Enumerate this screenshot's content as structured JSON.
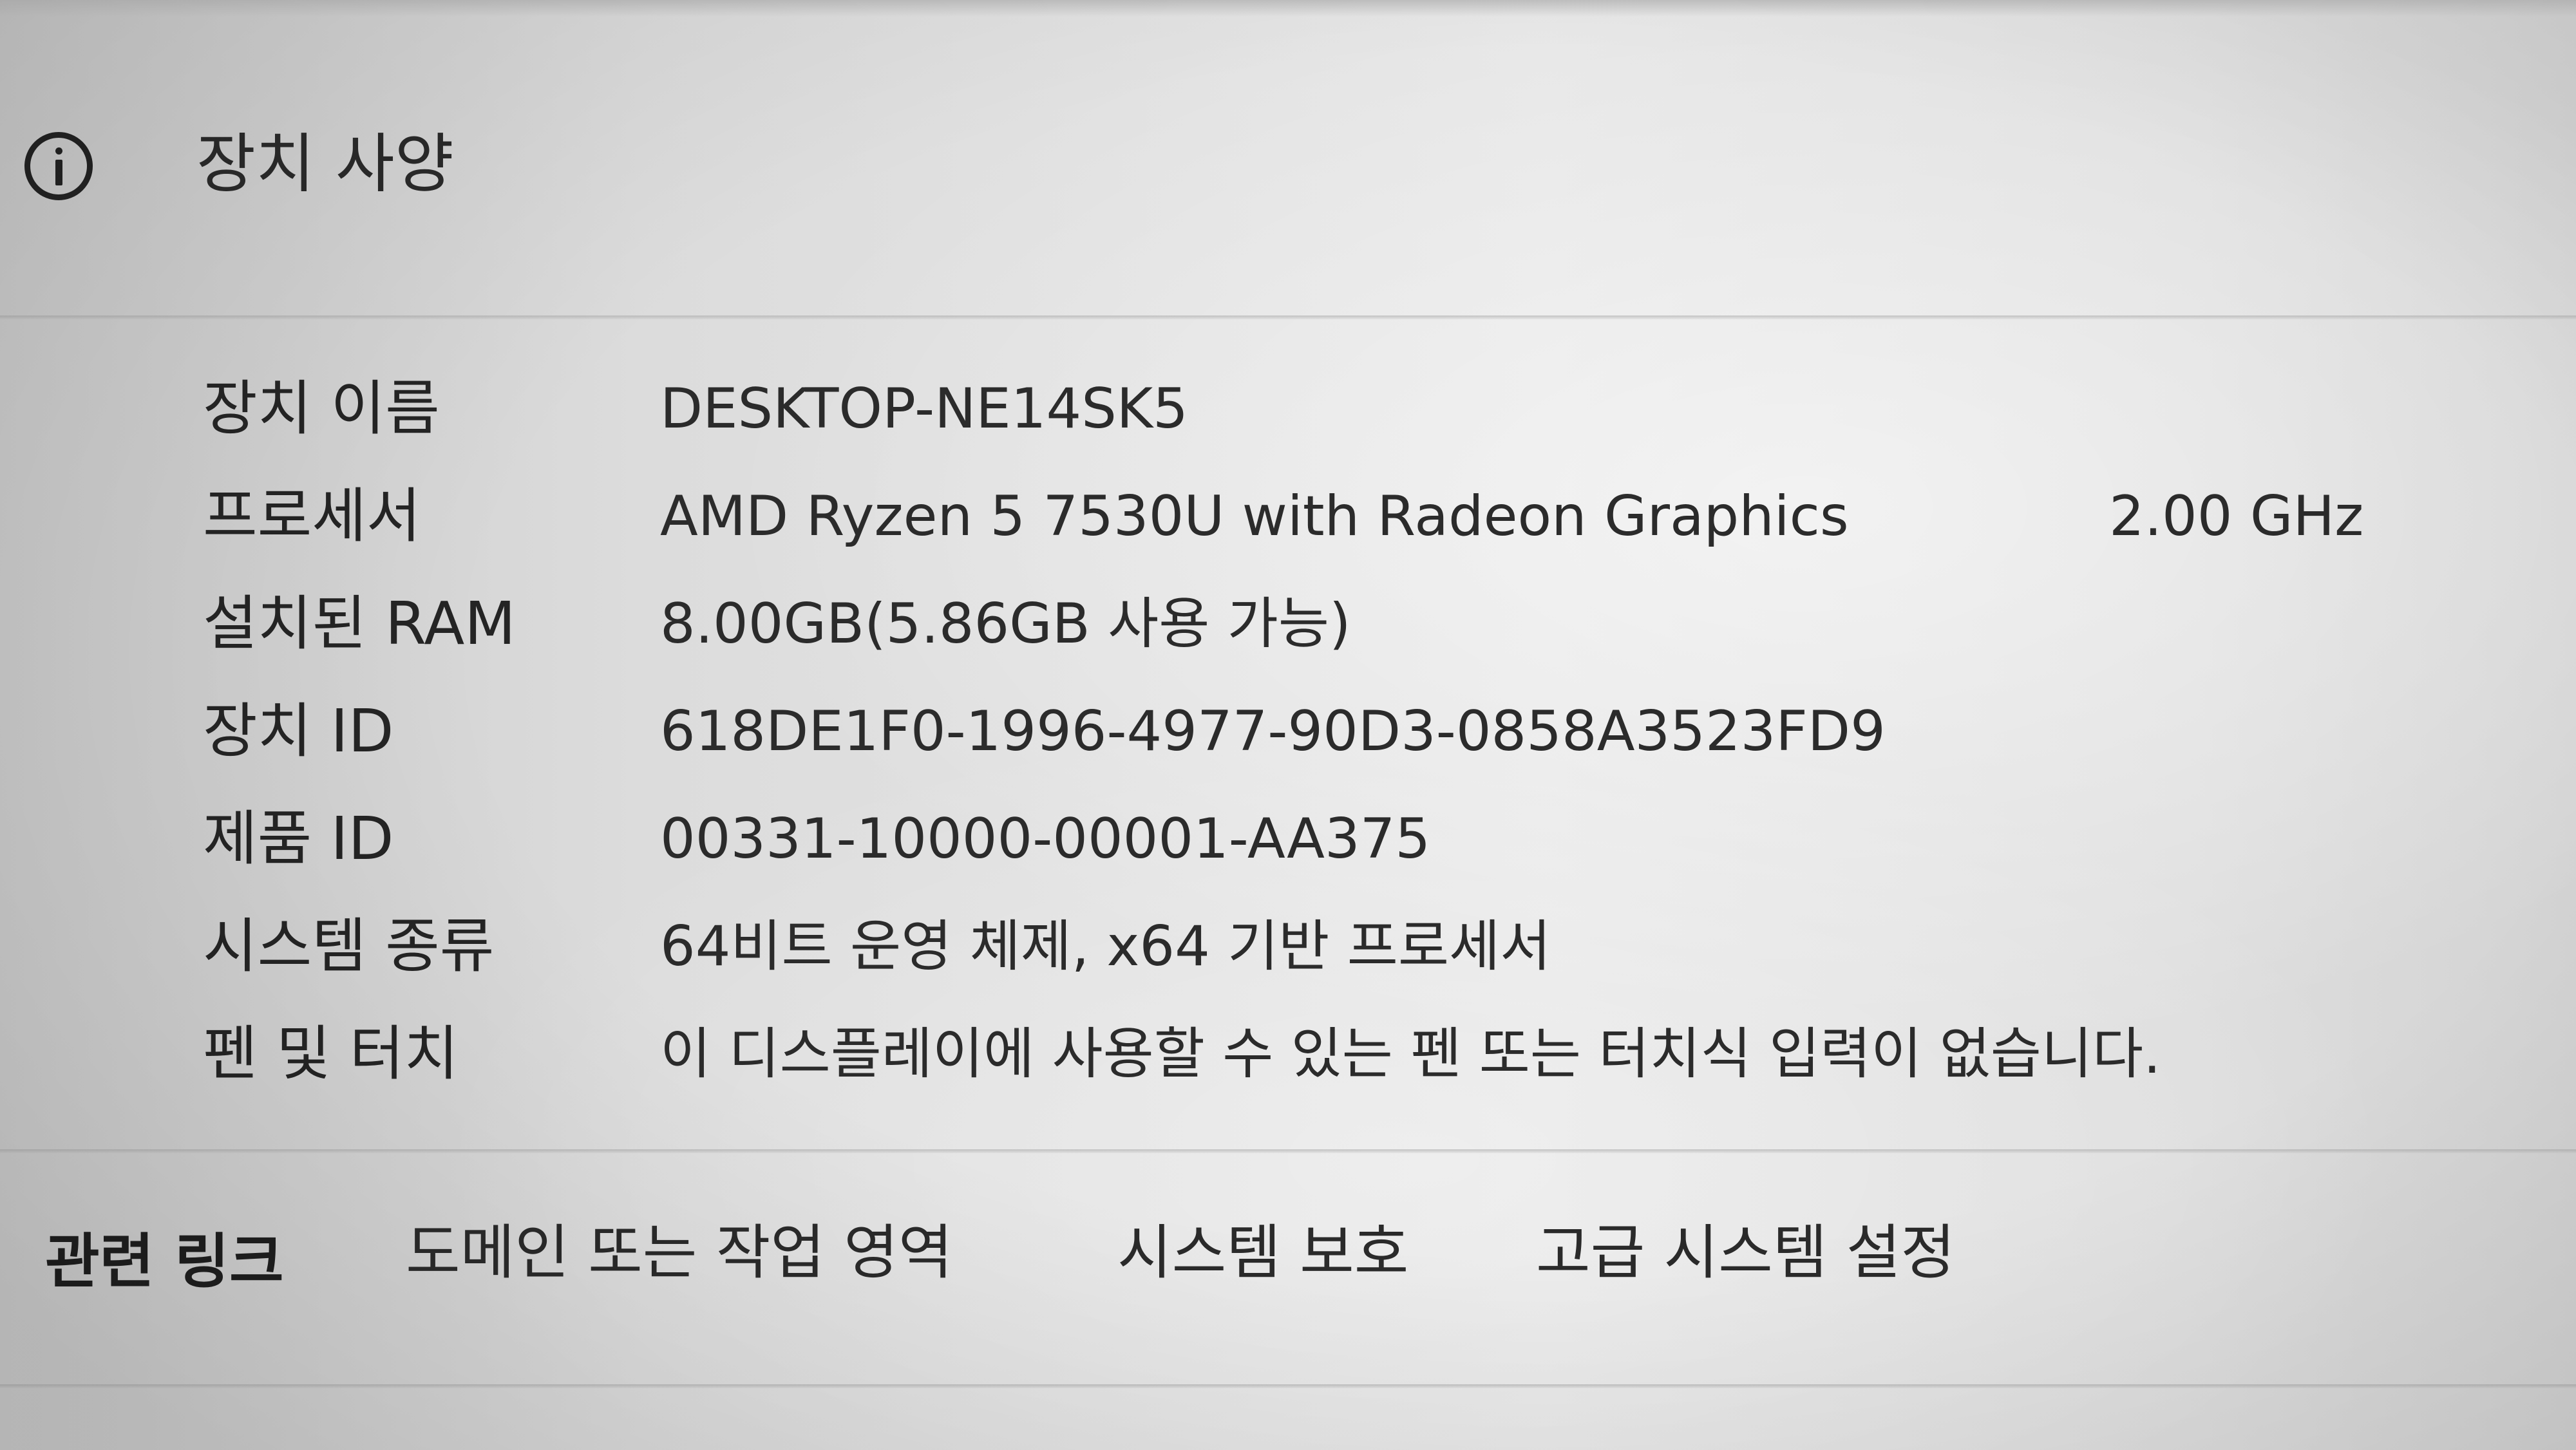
{
  "device_specs": {
    "title": "장치 사양",
    "rows": [
      {
        "label": "장치 이름",
        "value": "DESKTOP-NE14SK5"
      },
      {
        "label": "프로세서",
        "value": "AMD Ryzen 5 7530U with Radeon Graphics",
        "extra": "2.00 GHz"
      },
      {
        "label": "설치된 RAM",
        "value": "8.00GB(5.86GB 사용 가능)"
      },
      {
        "label": "장치 ID",
        "value": "618DE1F0-1996-4977-90D3-0858A3523FD9"
      },
      {
        "label": "제품 ID",
        "value": "00331-10000-00001-AA375"
      },
      {
        "label": "시스템 종류",
        "value": "64비트 운영 체제, x64 기반 프로세서"
      },
      {
        "label": "펜 및 터치",
        "value": "이 디스플레이에 사용할 수 있는 펜 또는 터치식 입력이 없습니다."
      }
    ]
  },
  "related_links": {
    "title": "관련 링크",
    "links": [
      "도메인 또는 작업 영역",
      "시스템 보호",
      "고급 시스템 설정"
    ]
  }
}
